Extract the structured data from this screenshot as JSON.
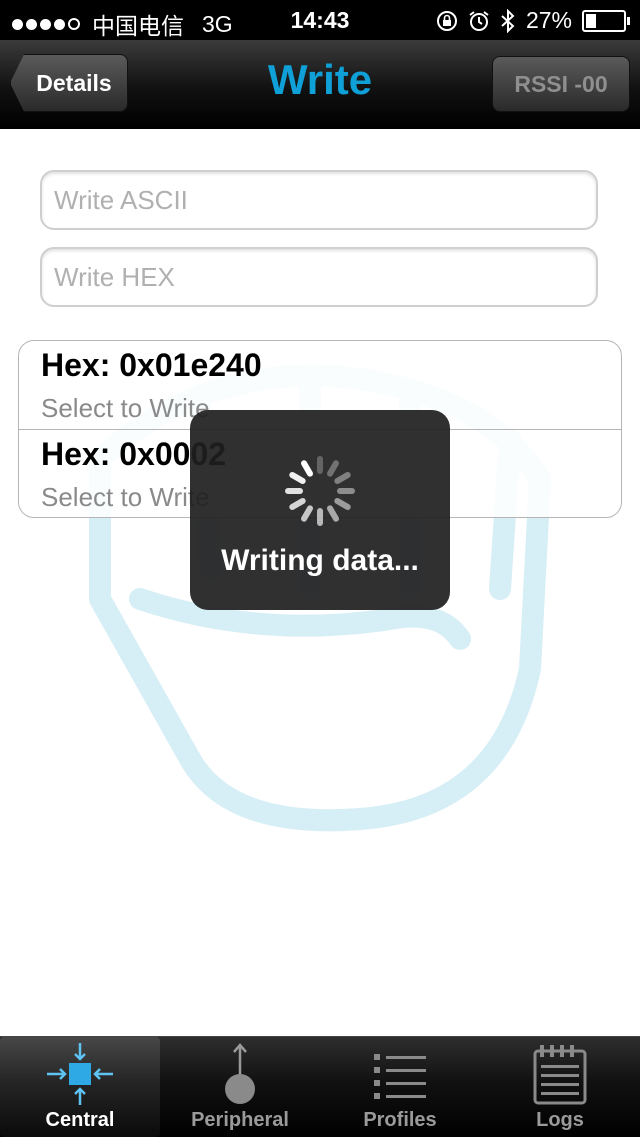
{
  "status_bar": {
    "carrier": "中国电信",
    "network": "3G",
    "time": "14:43",
    "battery": "27%",
    "battery_level": 0.27,
    "signal_bars_filled": 4,
    "signal_bars_total": 5,
    "icons": [
      "orientation-lock-icon",
      "alarm-icon",
      "bluetooth-icon",
      "battery-icon"
    ]
  },
  "nav": {
    "back_label": "Details",
    "title": "Write",
    "rssi_label": "RSSI -00",
    "title_color": "#0fa0d8"
  },
  "inputs": {
    "ascii_placeholder": "Write ASCII",
    "hex_placeholder": "Write HEX"
  },
  "values": [
    {
      "title": "Hex: 0x01e240",
      "subtitle": "Select to Write"
    },
    {
      "title": "Hex: 0x0002",
      "subtitle": "Select to Write"
    }
  ],
  "hud": {
    "text": "Writing data..."
  },
  "tabs": [
    {
      "label": "Central",
      "icon": "central-icon",
      "active": true
    },
    {
      "label": "Peripheral",
      "icon": "peripheral-icon",
      "active": false
    },
    {
      "label": "Profiles",
      "icon": "profiles-icon",
      "active": false
    },
    {
      "label": "Logs",
      "icon": "logs-icon",
      "active": false
    }
  ],
  "colors": {
    "accent": "#0fa0d8",
    "watermark": "#d6eef6"
  }
}
